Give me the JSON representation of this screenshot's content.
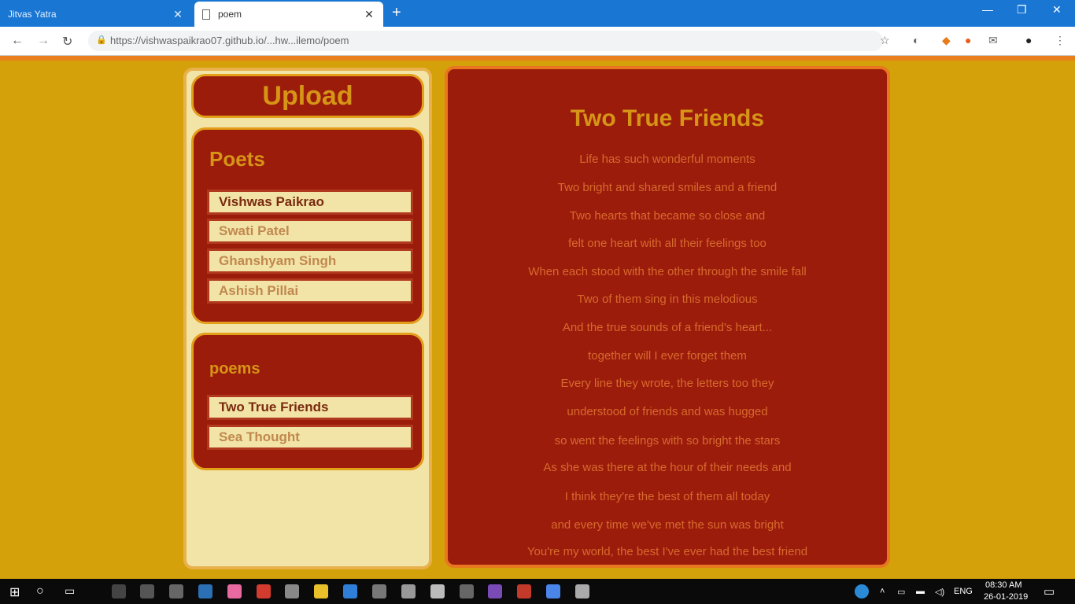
{
  "browser": {
    "tabs": [
      {
        "label": "Jitvas Yatra",
        "active": false
      },
      {
        "label": "poem",
        "active": true
      }
    ],
    "new_tab": "+",
    "url": "https://vishwaspaikrao07.github.io/...hw...ilemo/poem",
    "window_controls": [
      "—",
      "❐",
      "✕"
    ]
  },
  "sidebar": {
    "upload_label": "Upload",
    "poets_heading": "Poets",
    "poets": [
      "Vishwas Paikrao",
      "Swati Patel",
      "Ghanshyam Singh",
      "Ashish Pillai"
    ],
    "poems_heading": "poems",
    "poems": [
      "Two True Friends",
      "Sea Thought"
    ]
  },
  "poem": {
    "title": "Two True Friends",
    "lines": [
      "Life has such wonderful moments",
      "Two bright and shared smiles and a friend",
      "Two hearts that became so close and",
      "felt one heart with all their feelings too",
      "When each stood with the other through the smile fall",
      "Two of them sing in this melodious",
      "And the true sounds of a friend's heart...",
      "together will I ever forget them",
      "Every line they wrote, the letters too they",
      "understood of friends and was hugged",
      "so went the feelings with so bright the stars",
      "As she was there at the hour of their needs and",
      "I think they're the best of them all today",
      "and every time we've met the sun was bright",
      "You're my world, the best I've ever had the best friend"
    ]
  },
  "taskbar": {
    "language": "ENG",
    "time": "08:30 AM",
    "date": "26-01-2019"
  },
  "colors": {
    "page_bg": "#d4a10a",
    "panel_red": "#9c1c0c",
    "heading_gold": "#d69516",
    "cream": "#f2e4a6",
    "browser_blue": "#1976d2"
  }
}
